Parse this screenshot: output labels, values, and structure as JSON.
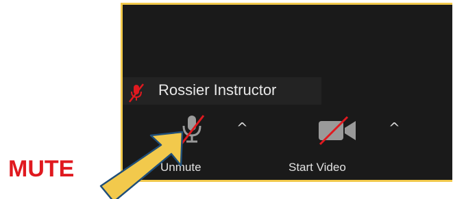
{
  "participant": {
    "name": "Rossier Instructor",
    "muted_icon": "mic-muted-icon"
  },
  "toolbar": {
    "unmute_label": "Unmute",
    "unmute_icon": "mic-muted-icon",
    "video_label": "Start Video",
    "video_icon": "video-off-icon",
    "caret_icon": "chevron-up-icon"
  },
  "annotation": {
    "label": "MUTE",
    "label_color": "#e0191f",
    "arrow_color": "#f2c94c"
  },
  "colors": {
    "panel_bg": "#1a1a1a",
    "frame": "#f2c94c",
    "strike": "#e0191f"
  }
}
